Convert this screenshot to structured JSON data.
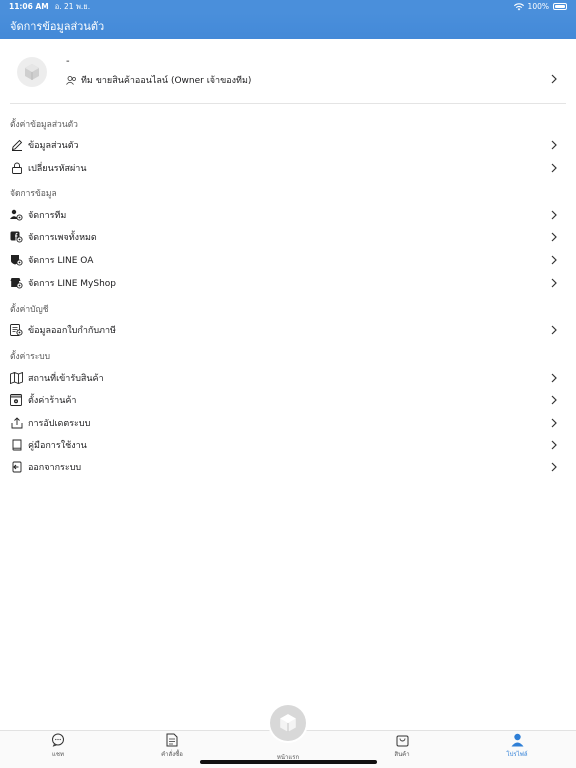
{
  "status_bar": {
    "time": "11:06 AM",
    "date": "อ. 21 พ.ย.",
    "battery": "100%"
  },
  "header": {
    "title": "จัดการข้อมูลส่วนตัว"
  },
  "profile": {
    "name": "-",
    "team": "ทีม ขายสินค้าออนไลน์ (Owner เจ้าของทีม)"
  },
  "sections": [
    {
      "title": "ตั้งค่าข้อมูลส่วนตัว",
      "items": [
        {
          "label": "ข้อมูลส่วนตัว",
          "icon": "pencil-icon"
        },
        {
          "label": "เปลี่ยนรหัสผ่าน",
          "icon": "lock-icon"
        }
      ]
    },
    {
      "title": "จัดการข้อมูล",
      "items": [
        {
          "label": "จัดการทีม",
          "icon": "team-gear-icon"
        },
        {
          "label": "จัดการเพจทั้งหมด",
          "icon": "facebook-gear-icon"
        },
        {
          "label": "จัดการ LINE OA",
          "icon": "line-oa-gear-icon"
        },
        {
          "label": "จัดการ LINE MyShop",
          "icon": "shop-gear-icon"
        }
      ]
    },
    {
      "title": "ตั้งค่าบัญชี",
      "items": [
        {
          "label": "ข้อมูลออกใบกำกับภาษี",
          "icon": "invoice-icon"
        }
      ]
    },
    {
      "title": "ตั้งค่าระบบ",
      "items": [
        {
          "label": "สถานที่เข้ารับสินค้า",
          "icon": "map-icon"
        },
        {
          "label": "ตั้งค่าร้านค้า",
          "icon": "store-gear-icon"
        },
        {
          "label": "การอัปเดตระบบ",
          "icon": "upload-icon"
        },
        {
          "label": "คู่มือการใช้งาน",
          "icon": "book-icon"
        },
        {
          "label": "ออกจากระบบ",
          "icon": "logout-icon"
        }
      ]
    }
  ],
  "tabs": [
    {
      "label": "แชท",
      "icon": "chat-icon"
    },
    {
      "label": "คำสั่งซื้อ",
      "icon": "order-icon"
    },
    {
      "label": "หน้าแรก",
      "icon": "home-box-icon"
    },
    {
      "label": "สินค้า",
      "icon": "bag-icon"
    },
    {
      "label": "โปรไฟล์",
      "icon": "profile-icon",
      "active": true
    }
  ],
  "colors": {
    "accent": "#4a8fdb",
    "active_tab": "#2f7fd6"
  }
}
